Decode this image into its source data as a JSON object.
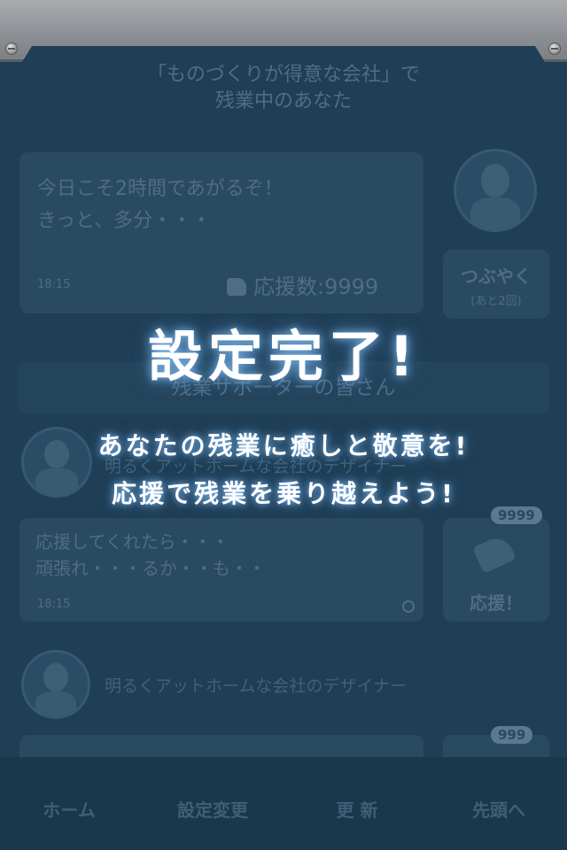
{
  "header": {
    "title_line1": "「ものづくりが得意な会社」で",
    "title_line2": "残業中のあなた"
  },
  "my_post": {
    "text_line1": "今日こそ2時間であがるぞ！",
    "text_line2": "きっと、多分・・・",
    "time": "18:15",
    "cheer_label": "応援数:",
    "cheer_count": "9999"
  },
  "tweet_button": {
    "label": "つぶやく",
    "sub": "(あと2回)"
  },
  "supporters": {
    "section_title": "残業サポーターの皆さん"
  },
  "posts": [
    {
      "name": "明るくアットホームな会社のデザイナー",
      "text_line1": "応援してくれたら・・・",
      "text_line2": "頑張れ・・・るか・・も・・",
      "time": "18:15",
      "badge": "9999",
      "cheer_button": "応援！"
    },
    {
      "name": "明るくアットホームな会社のデザイナー",
      "badge": "999"
    }
  ],
  "tabbar": {
    "tabs": [
      {
        "label": "ホーム"
      },
      {
        "label": "設定変更"
      },
      {
        "label": "更 新"
      },
      {
        "label": "先頭へ"
      }
    ]
  },
  "overlay": {
    "title": "設定完了!",
    "line1": "あなたの残業に癒しと敬意を!",
    "line2": "応援で残業を乗り越えよう!"
  }
}
